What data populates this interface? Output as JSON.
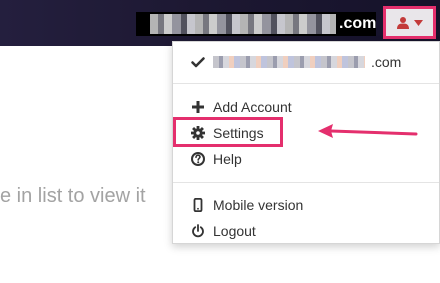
{
  "header": {
    "account_domain": ".com",
    "user_menu": {
      "icon": "user-icon",
      "caret_icon": "caret-down-icon"
    }
  },
  "page": {
    "hint_text": "e in list to view it"
  },
  "dropdown": {
    "account_email_domain": ".com",
    "items": [
      {
        "label": "Add Account",
        "icon": "plus-icon"
      },
      {
        "label": "Settings",
        "icon": "gear-icon"
      },
      {
        "label": "Help",
        "icon": "question-circle-icon"
      },
      {
        "label": "Mobile version",
        "icon": "mobile-icon"
      },
      {
        "label": "Logout",
        "icon": "power-icon"
      }
    ]
  },
  "colors": {
    "header_dark": "#1d1832",
    "highlight_pink": "#e42f6d",
    "text_dark": "#333333",
    "page_hint": "#a3a3a3"
  }
}
